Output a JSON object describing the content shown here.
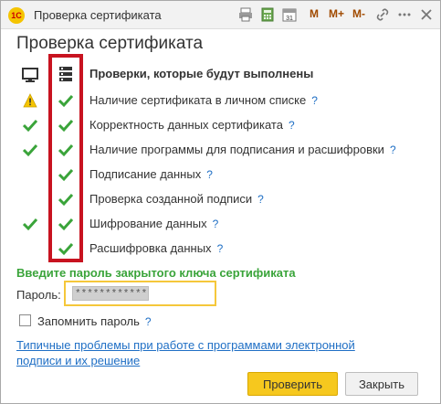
{
  "window": {
    "title": "Проверка сертификата",
    "toolbar": {
      "m_label": "M",
      "m_plus_label": "M+",
      "m_minus_label": "M-"
    }
  },
  "dialog": {
    "title": "Проверка сертификата",
    "checks_header": "Проверки, которые будут выполнены",
    "help_mark": "?",
    "checks": [
      {
        "label": "Наличие сертификата в личном списке",
        "computer_status": "warning",
        "server_status": "ok"
      },
      {
        "label": "Корректность данных сертификата",
        "computer_status": "ok",
        "server_status": "ok"
      },
      {
        "label": "Наличие программы для подписания и расшифровки",
        "computer_status": "ok",
        "server_status": "ok"
      },
      {
        "label": "Подписание данных",
        "computer_status": "none",
        "server_status": "ok"
      },
      {
        "label": "Проверка созданной подписи",
        "computer_status": "none",
        "server_status": "ok"
      },
      {
        "label": "Шифрование данных",
        "computer_status": "ok",
        "server_status": "ok"
      },
      {
        "label": "Расшифровка данных",
        "computer_status": "none",
        "server_status": "ok"
      }
    ],
    "password_prompt": "Введите пароль закрытого ключа сертификата",
    "password_label": "Пароль:",
    "password_value": "***************",
    "remember_label": "Запомнить пароль",
    "remember_checked": false,
    "link_text": "Типичные проблемы при работе с программами электронной подписи и их решение",
    "check_button": "Проверить",
    "close_button": "Закрыть"
  },
  "colors": {
    "check_green": "#3aa43a",
    "warning_yellow": "#f5c400",
    "highlight_red": "#c81320",
    "primary_button": "#f6c81e"
  }
}
